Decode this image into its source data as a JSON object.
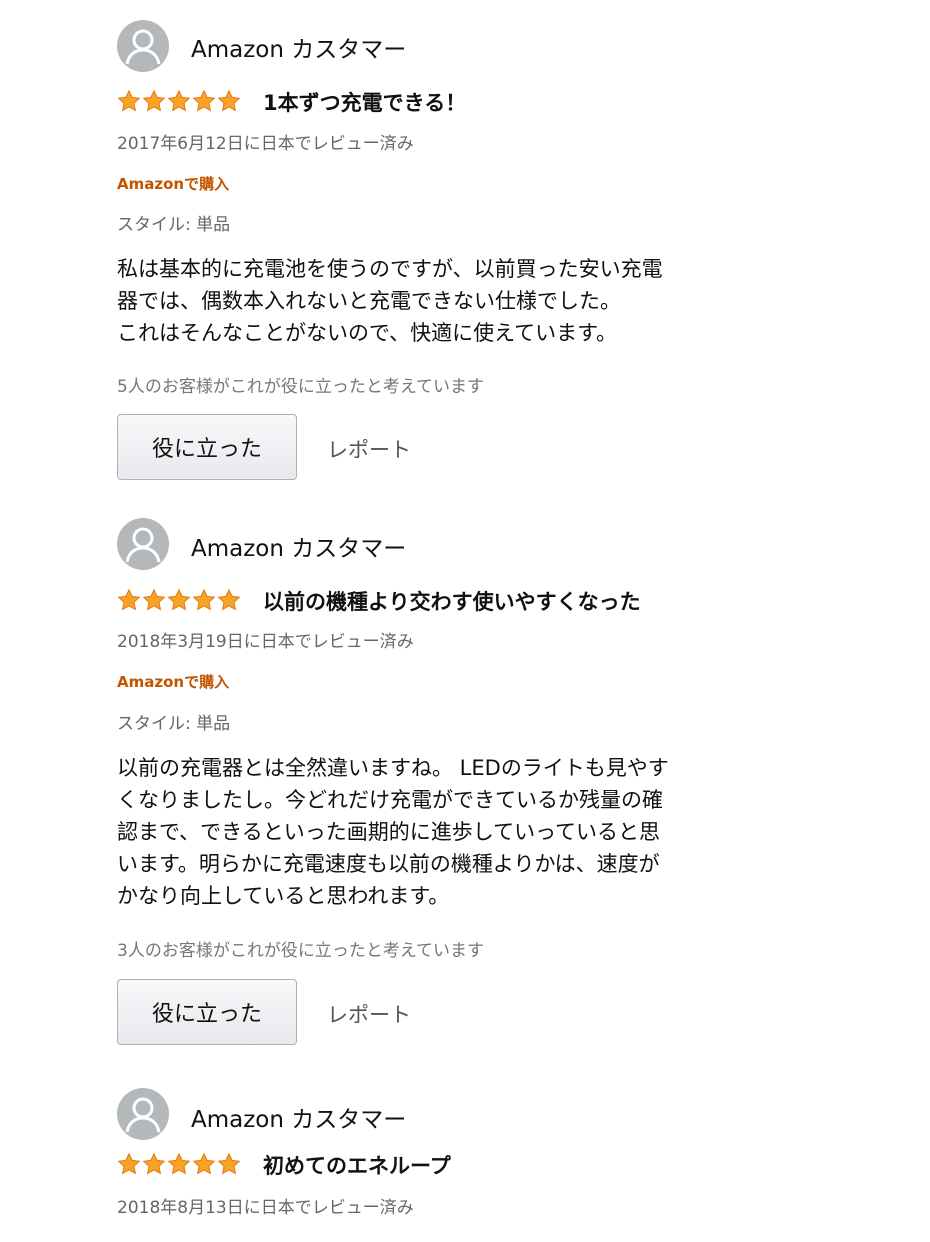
{
  "reviews": [
    {
      "reviewer": "Amazon カスタマー",
      "rating": 5,
      "title": "1本ずつ充電できる！",
      "date": "2017年6月12日に日本でレビュー済み",
      "verified": "Amazonで購入",
      "style": "スタイル: 単品",
      "body_lines": [
        "私は基本的に充電池を使うのですが、以前買った安い充電",
        "器では、偶数本入れないと充電できない仕様でした。",
        "これはそんなことがないので、快適に使えています。"
      ],
      "helpful_count": "5人のお客様がこれが役に立ったと考えています",
      "helpful_button": "役に立った",
      "report_link": "レポート"
    },
    {
      "reviewer": "Amazon カスタマー",
      "rating": 5,
      "title": "以前の機種より交わす使いやすくなった",
      "date": "2018年3月19日に日本でレビュー済み",
      "verified": "Amazonで購入",
      "style": "スタイル: 単品",
      "body_lines": [
        "以前の充電器とは全然違いますね。 LEDのライトも見やす",
        "くなりましたし。今どれだけ充電ができているか残量の確",
        "認まで、できるといった画期的に進歩していっていると思",
        "います。明らかに充電速度も以前の機種よりかは、速度が",
        "かなり向上していると思われます。"
      ],
      "helpful_count": "3人のお客様がこれが役に立ったと考えています",
      "helpful_button": "役に立った",
      "report_link": "レポート"
    },
    {
      "reviewer": "Amazon カスタマー",
      "rating": 5,
      "title": "初めてのエネループ",
      "date": "2018年8月13日に日本でレビュー済み"
    }
  ],
  "colors": {
    "star": "#f7a325",
    "star_outline": "#e47911",
    "verified": "#c45500",
    "meta_text": "#666666",
    "avatar": "#b5b8ba"
  },
  "icons": {
    "avatar": "user-silhouette-icon",
    "star": "star-filled-icon"
  }
}
